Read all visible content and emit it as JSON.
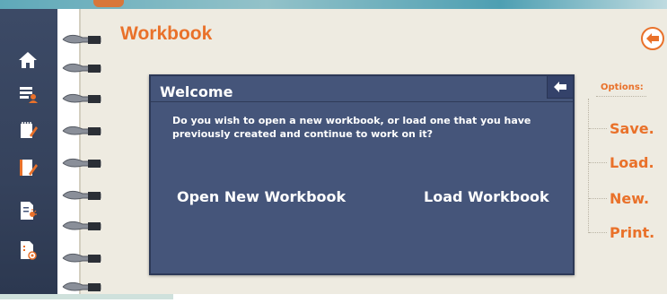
{
  "header": {
    "title": "Workbook"
  },
  "dialog": {
    "title": "Welcome",
    "message": "Do you wish to open a new workbook, or load one that you have previously created and continue to work on it?",
    "open_new_label": "Open New Workbook",
    "load_label": "Load Workbook"
  },
  "options": {
    "header": "Options:",
    "items": [
      {
        "label": "Save."
      },
      {
        "label": "Load."
      },
      {
        "label": "New."
      },
      {
        "label": "Print."
      }
    ]
  },
  "sidebar": {
    "items": [
      {
        "icon": "home-icon"
      },
      {
        "icon": "profile-list-icon"
      },
      {
        "icon": "notepad-edit-icon"
      },
      {
        "icon": "document-edit-icon"
      },
      {
        "icon": "document-idea-icon"
      },
      {
        "icon": "document-target-icon"
      }
    ]
  },
  "colors": {
    "accent": "#e9712a",
    "dialog_bg": "#45557a",
    "sidebar_bg": "#3c4a66",
    "paper": "#eeebe1"
  }
}
